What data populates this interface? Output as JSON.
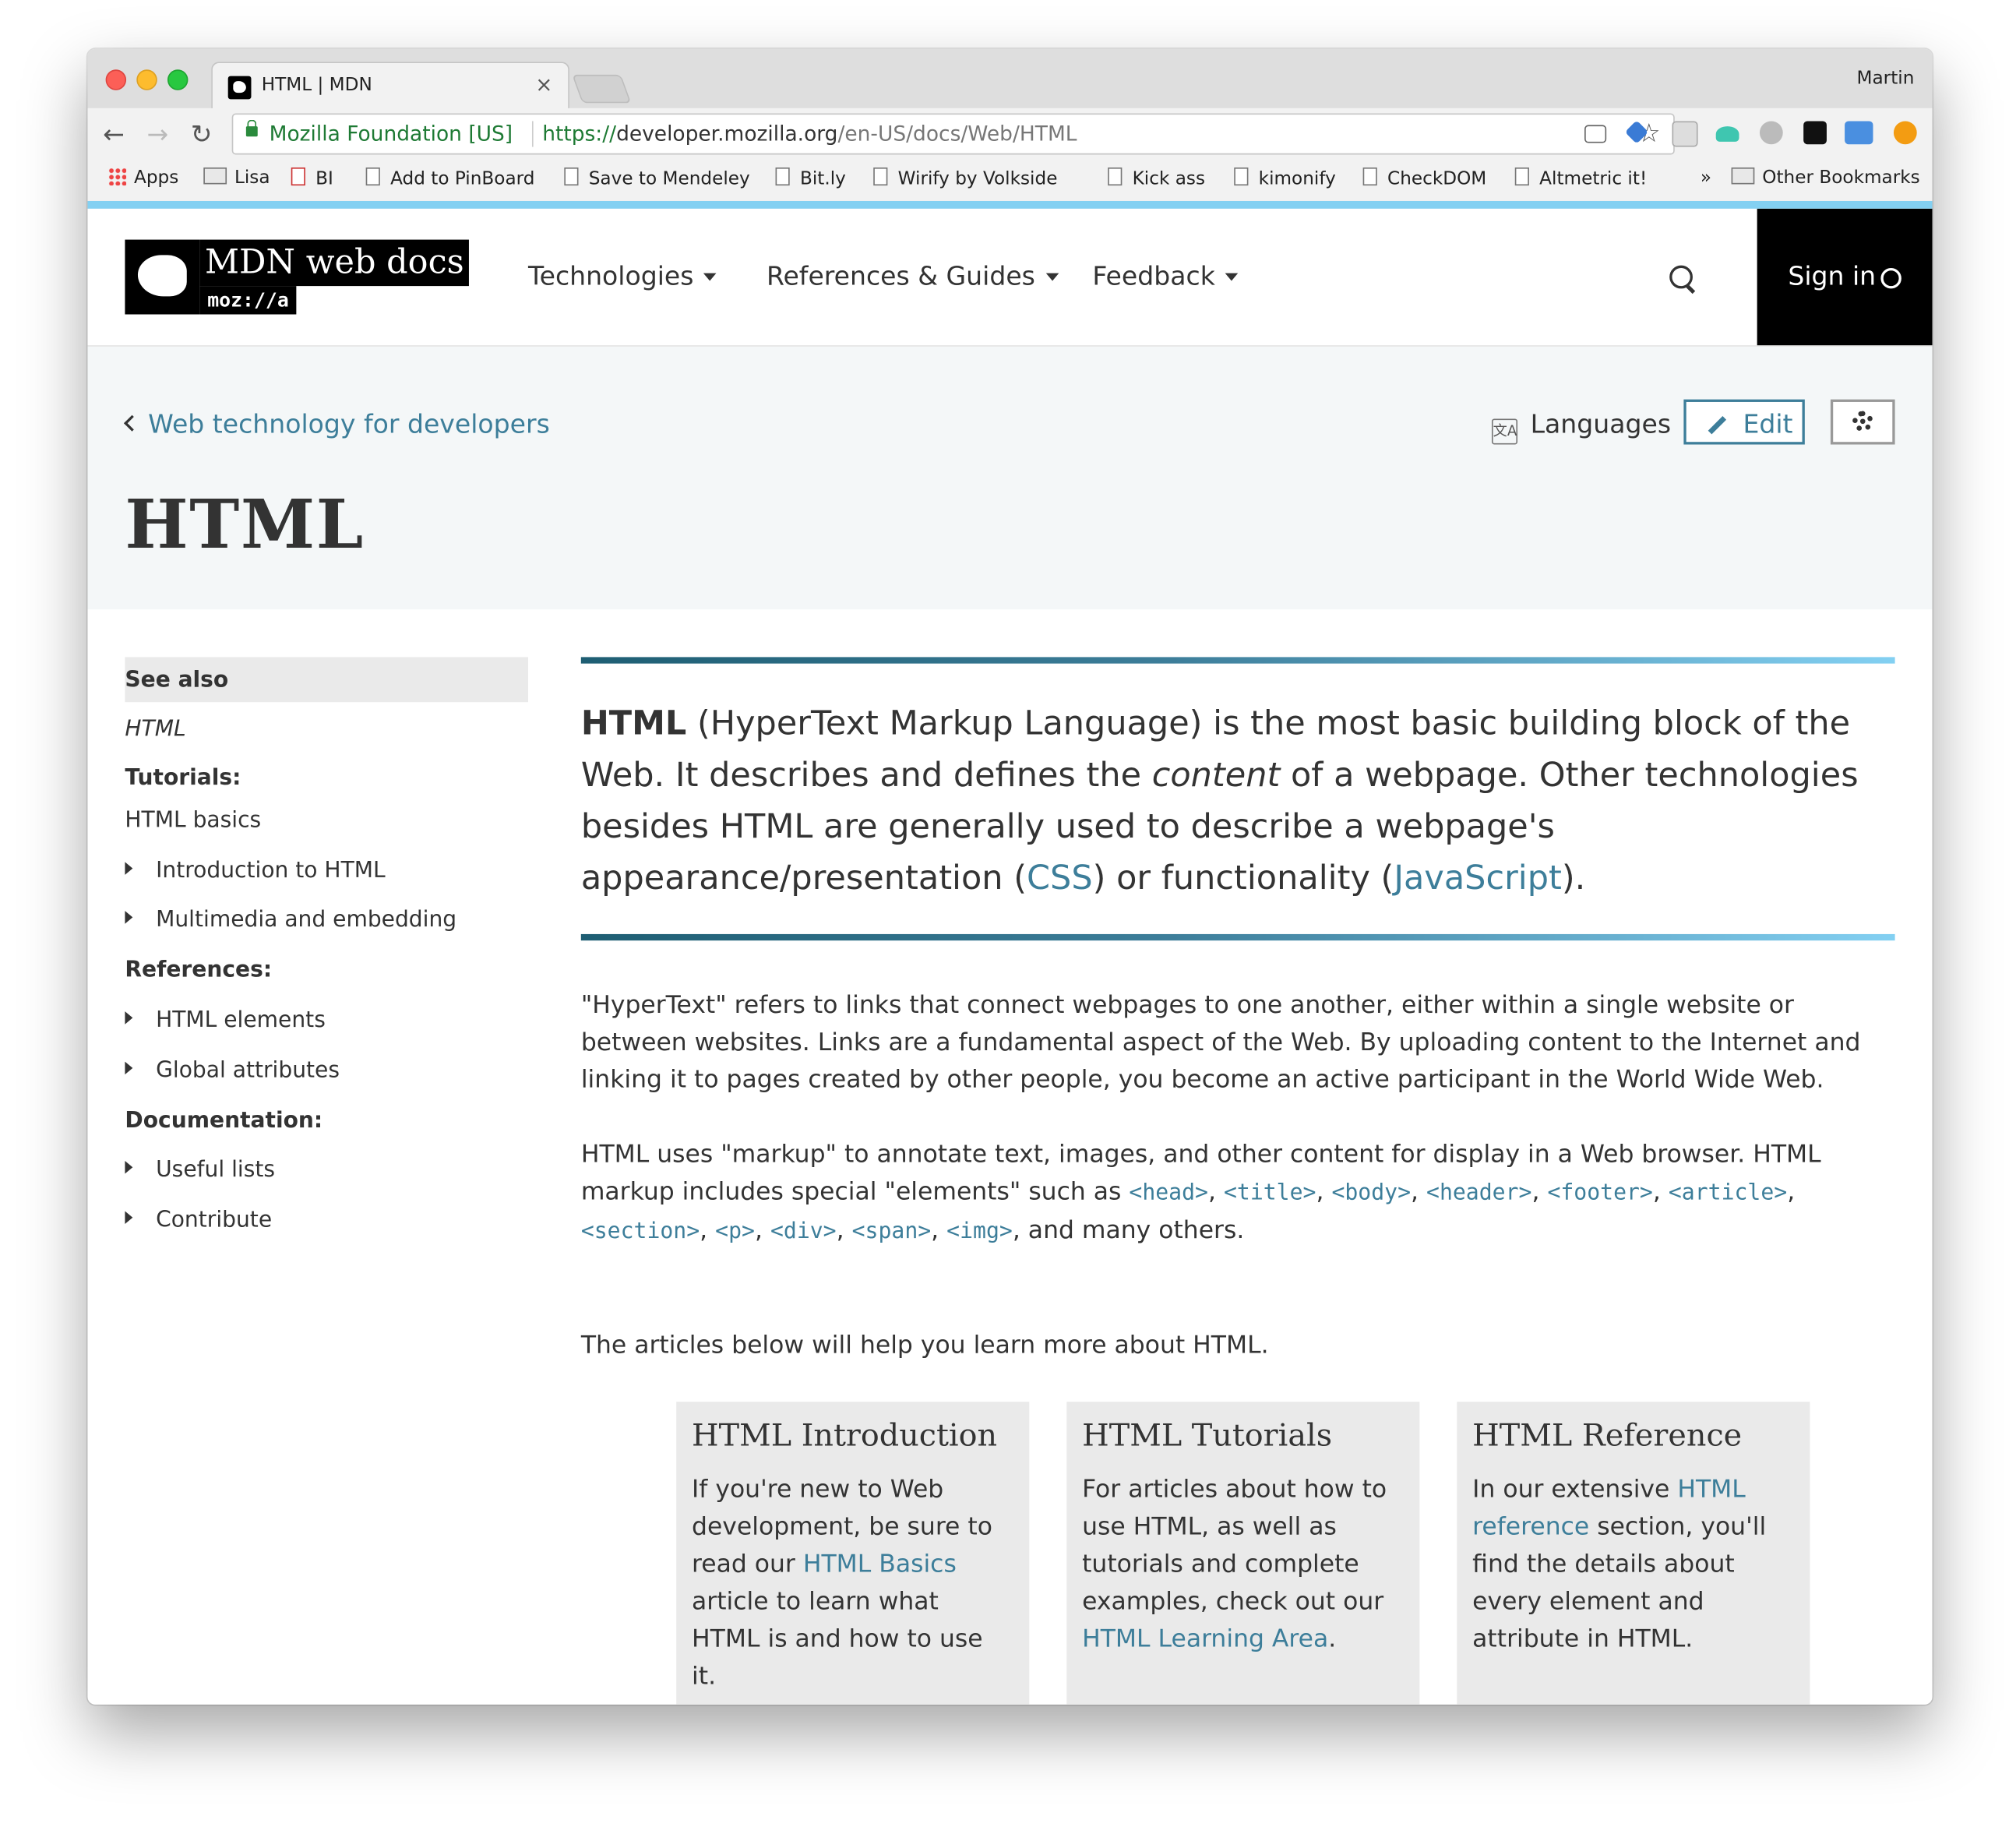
{
  "browser": {
    "tab_title": "HTML | MDN",
    "tab_close": "×",
    "profile": "Martin",
    "back_icon": "←",
    "forward_icon": "→",
    "reload_icon": "↻",
    "org": "Mozilla Foundation [US]",
    "url_proto": "https://",
    "url_host": "developer.mozilla.org",
    "url_path": "/en-US/docs/Web/HTML",
    "star_icon": "☆",
    "bookmarks": {
      "apps": "Apps",
      "lisa": "Lisa",
      "bi": "BI",
      "pinboard": "Add to PinBoard",
      "mendeley": "Save to Mendeley",
      "bitly": "Bit.ly",
      "wirify": "Wirify by Volkside",
      "kickass": "Kick ass",
      "kimonify": "kimonify",
      "checkdom": "CheckDOM",
      "altmetric": "Altmetric it!",
      "more": "»",
      "other": "Other Bookmarks"
    }
  },
  "header": {
    "logo_title": "MDN web docs",
    "logo_moz": "moz://a",
    "nav": [
      "Technologies",
      "References & Guides",
      "Feedback"
    ],
    "signin": "Sign in"
  },
  "titleband": {
    "breadcrumb": "Web technology for developers",
    "languages": "Languages",
    "lang_icon_text": "文A",
    "edit": "Edit",
    "title": "HTML"
  },
  "sidebar": {
    "see_also": "See also",
    "html": "HTML",
    "tutorials": "Tutorials:",
    "html_basics": "HTML basics",
    "intro": "Introduction to HTML",
    "multimedia": "Multimedia and embedding",
    "references": "References:",
    "elements": "HTML elements",
    "attributes": "Global attributes",
    "documentation": "Documentation:",
    "useful": "Useful lists",
    "contribute": "Contribute"
  },
  "article": {
    "summary": {
      "strong": "HTML",
      "t1": " (HyperText Markup Language) is the most basic building block of the Web. It describes and defines the ",
      "em": "content",
      "t2": " of a webpage. Other technologies besides HTML are generally used to describe a webpage's appearance/presentation (",
      "css": "CSS",
      "t3": ") or functionality (",
      "js": "JavaScript",
      "t4": ")."
    },
    "p1": "\"HyperText\" refers to links that connect webpages to one another, either within a single website or between websites. Links are a fundamental aspect of the Web. By uploading content to the Internet and linking it to pages created by other people, you become an active participant in the World Wide Web.",
    "p2": {
      "t1": "HTML uses \"markup\" to annotate text, images, and other content for display in a Web browser. HTML markup includes special \"elements\" such as ",
      "codes": [
        "<head>",
        "<title>",
        "<body>",
        "<header>",
        "<footer>",
        "<article>",
        "<section>",
        "<p>",
        "<div>",
        "<span>",
        "<img>"
      ],
      "sep": ", ",
      "t2": ", and many others."
    },
    "p3": "The articles below will help you learn more about HTML.",
    "cards": [
      {
        "title": "HTML Introduction",
        "t1": "If you're new to Web development, be sure to read our ",
        "link": "HTML Basics",
        "t2": " article to learn what HTML is and how to use it."
      },
      {
        "title": "HTML Tutorials",
        "t1": "For articles about how to use HTML, as well as tutorials and complete examples, check out our ",
        "link": "HTML Learning Area",
        "t2": "."
      },
      {
        "title": "HTML Reference",
        "t1": "In our extensive ",
        "link": "HTML reference",
        "t2": " section, you'll find the details about every element and attribute in HTML."
      }
    ]
  }
}
